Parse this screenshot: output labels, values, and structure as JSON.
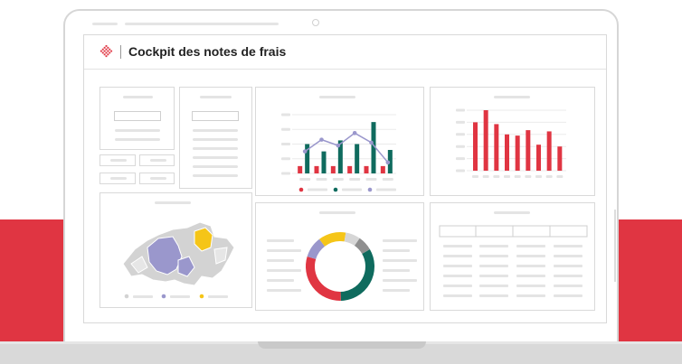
{
  "app": {
    "title": "Cockpit des notes de frais",
    "logo_icon": "red-diamond-logo"
  },
  "colors": {
    "brand_red": "#e03542",
    "teal": "#0f6b5e",
    "purple": "#9a97cc",
    "yellow": "#f5c518",
    "gray": "#c9c9c9"
  },
  "chart_data": [
    {
      "type": "bar",
      "series": [
        {
          "color": "#e03542",
          "values": [
            1,
            1,
            1,
            1,
            1,
            1
          ]
        },
        {
          "color": "#0f6b5e",
          "values": [
            4,
            3,
            4.5,
            4,
            7,
            3.2
          ]
        },
        {
          "color": "#9a97cc",
          "values": [
            3,
            4.6,
            3.8,
            5.5,
            4.2,
            1.5
          ]
        }
      ]
    },
    {
      "type": "bar",
      "values": [
        8,
        10,
        7.7,
        6,
        5.8,
        6.7,
        4.3,
        6.5,
        4
      ]
    },
    {
      "type": "pie",
      "values": [
        33,
        30,
        10,
        13,
        7,
        7
      ],
      "colors": [
        "#0f6b5e",
        "#e03542",
        "#9a97cc",
        "#f5c518",
        "#d6d6d6",
        "#8f8f8f"
      ]
    }
  ]
}
